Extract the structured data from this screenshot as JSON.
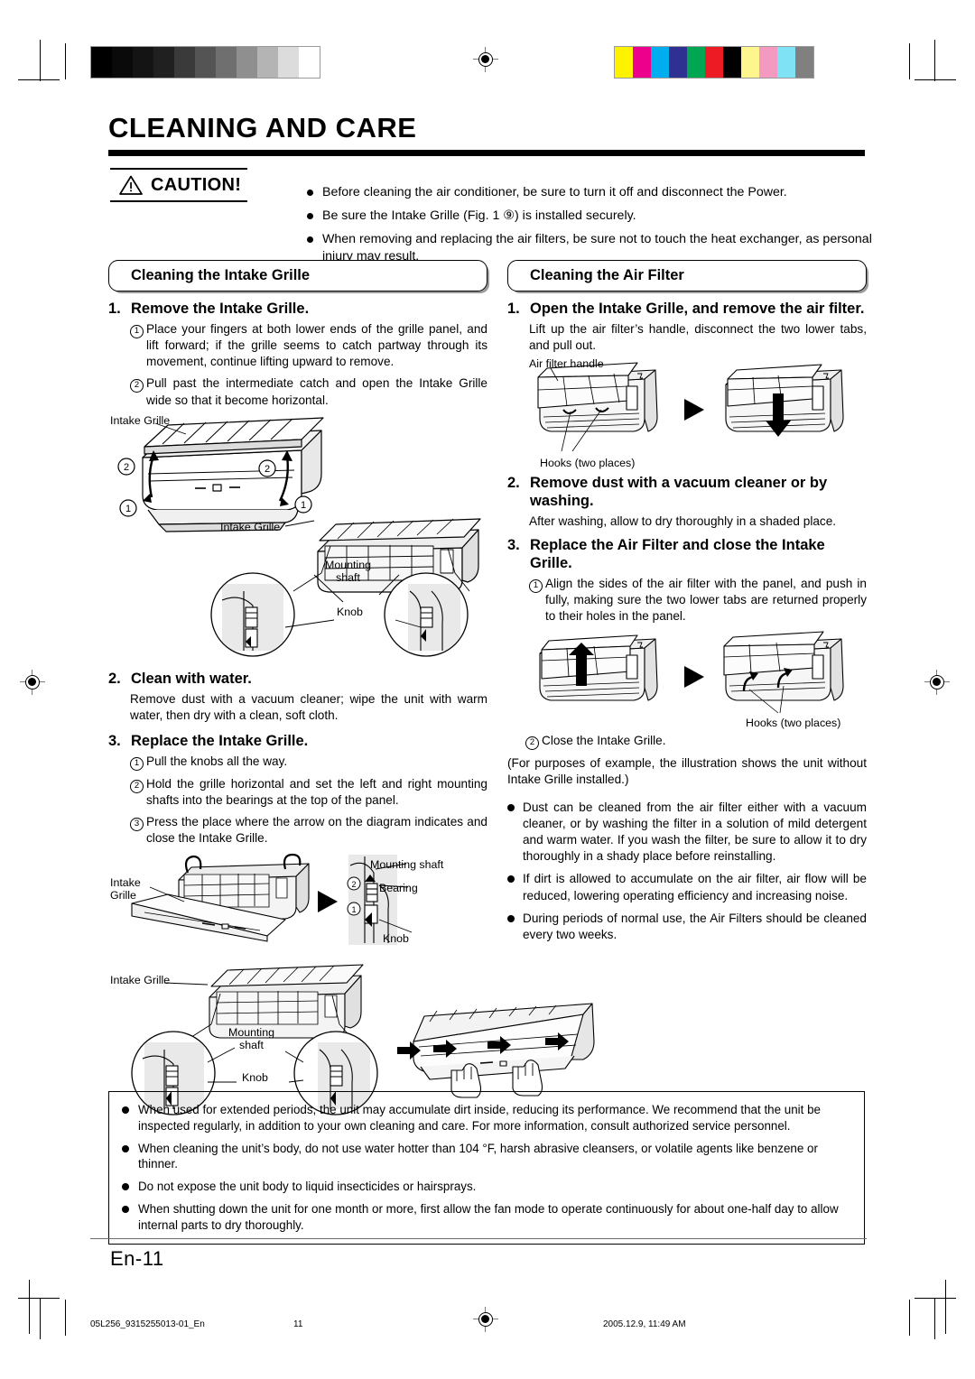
{
  "document": {
    "title": "CLEANING AND CARE",
    "page_label": "En-11"
  },
  "caution": {
    "label": "CAUTION!",
    "icon": "warning-triangle-icon",
    "items": [
      "Before cleaning the air conditioner, be sure to turn it off and disconnect the Power.",
      "Be sure the Intake Grille (Fig. 1 ⑨) is installed securely.",
      "When removing and replacing the air filters, be sure not to touch the heat exchanger, as personal injury may result."
    ]
  },
  "left_column": {
    "section_heading": "Cleaning the Intake Grille",
    "step1": {
      "number": "1.",
      "title": "Remove the Intake Grille.",
      "subs": [
        {
          "marker": "1",
          "text": "Place your fingers at both lower ends of the grille panel, and lift forward; if the grille seems to catch partway through its movement, continue lifting upward to remove."
        },
        {
          "marker": "2",
          "text": "Pull past the intermediate catch and open the Intake Grille wide so that it become horizontal."
        }
      ]
    },
    "figure1": {
      "labels": [
        "Intake Grille",
        "Intake Grille",
        "Mounting\nshaft",
        "Knob"
      ],
      "callouts": [
        "2",
        "2",
        "1",
        "1"
      ]
    },
    "step2": {
      "number": "2.",
      "title": "Clean with water.",
      "text": "Remove dust with a vacuum cleaner; wipe the unit with warm water, then dry with a clean, soft cloth."
    },
    "step3": {
      "number": "3.",
      "title": "Replace the Intake Grille.",
      "subs": [
        {
          "marker": "1",
          "text": "Pull the knobs all the way."
        },
        {
          "marker": "2",
          "text": "Hold the grille horizontal and set the left and right mounting shafts into the bearings at the top of the panel."
        },
        {
          "marker": "3",
          "text": "Press the place where the arrow on the diagram indicates and close the Intake Grille."
        }
      ]
    },
    "figure2": {
      "labels": [
        "Intake\nGrille",
        "Mounting shaft",
        "Bearing",
        "Knob"
      ],
      "callouts": [
        "2",
        "1"
      ]
    },
    "figure3": {
      "labels": [
        "Intake Grille",
        "Mounting\nshaft",
        "Knob"
      ]
    }
  },
  "right_column": {
    "section_heading": "Cleaning the Air Filter",
    "step1": {
      "number": "1.",
      "title": "Open the Intake Grille, and remove the air filter.",
      "text": "Lift up the air filter’s handle, disconnect the two lower tabs, and pull out."
    },
    "figure1": {
      "labels": [
        "Air filter handle",
        "Hooks (two places)"
      ]
    },
    "step2": {
      "number": "2.",
      "title": "Remove dust with a vacuum cleaner or by washing.",
      "text": "After washing, allow to dry thoroughly in a shaded place."
    },
    "step3": {
      "number": "3.",
      "title": "Replace the Air Filter and close the Intake Grille.",
      "subs": [
        {
          "marker": "1",
          "text": "Align the sides of the air filter with the panel, and push in fully, making sure the two lower tabs are returned properly to their holes in the panel."
        }
      ]
    },
    "figure2": {
      "labels": [
        "Hooks (two places)"
      ]
    },
    "after_figure": {
      "marker": "2",
      "text": "Close the Intake Grille.",
      "note": "(For purposes of example, the illustration shows the unit without Intake Grille installed.)"
    },
    "bullets": [
      "Dust can be cleaned from the air filter either with a vacuum cleaner, or by washing the filter in a solution of mild detergent and warm water. If you wash the filter, be sure to allow it to dry thoroughly in a shady place before reinstalling.",
      "If dirt is allowed to accumulate on the air filter, air flow will be reduced, lowering operating efficiency and increasing noise.",
      "During periods of normal use, the Air Filters should be cleaned every two weeks."
    ]
  },
  "notes_box": [
    "When used for extended periods, the unit may accumulate dirt inside, reducing its performance. We recommend that the unit be inspected regularly, in addition to your own cleaning and care. For more information, consult authorized service personnel.",
    "When cleaning the unit’s body, do not use water hotter than 104 °F, harsh abrasive cleansers, or volatile agents like benzene or thinner.",
    "Do not expose the unit body to liquid insecticides or hairsprays.",
    "When shutting down the unit for one month or more, first allow the fan mode to operate continuously for about one-half day to allow internal parts to dry thoroughly."
  ],
  "footer": {
    "file": "05L256_9315255013-01_En",
    "page": "11",
    "timestamp": "2005.12.9, 11:49 AM"
  },
  "print_marks": {
    "gray_ramp": [
      "#000000",
      "#0a0a0a",
      "#141414",
      "#202020",
      "#3a3a3a",
      "#545454",
      "#6f6f6f",
      "#8f8f8f",
      "#b4b4b4",
      "#dcdcdc",
      "#ffffff"
    ],
    "color_swatches": [
      "#fff200",
      "#ec008c",
      "#00aeef",
      "#2e3192",
      "#00a651",
      "#ed1c24",
      "#000000",
      "#fff58f",
      "#f49ac1",
      "#7fe3f5",
      "#808080"
    ]
  }
}
